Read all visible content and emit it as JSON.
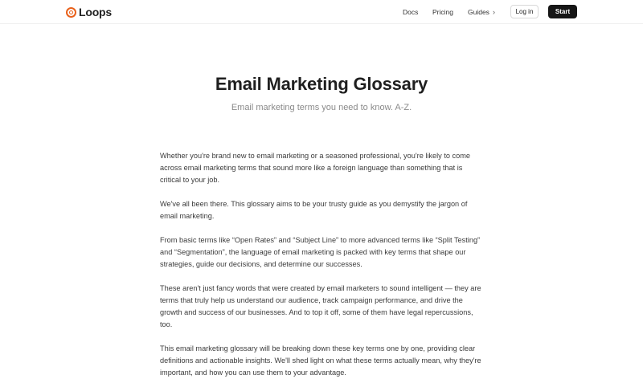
{
  "header": {
    "logo_text": "Loops",
    "nav": {
      "docs": "Docs",
      "pricing": "Pricing",
      "guides": "Guides",
      "guides_chevron": "›"
    },
    "login_label": "Log in",
    "start_label": "Start",
    "brand_color": "#e9611b"
  },
  "hero": {
    "title": "Email Marketing Glossary",
    "subtitle": "Email marketing terms you need to know. A-Z."
  },
  "article": {
    "paragraphs": [
      "Whether you're brand new to email marketing or a seasoned professional, you're likely to come across email marketing terms that sound more like a foreign language than something that is critical to your job.",
      "We've all been there. This glossary aims to be your trusty guide as you demystify the jargon of email marketing.",
      "From basic terms like “Open Rates” and “Subject Line” to more advanced terms like “Split Testing” and “Segmentation”, the language of email marketing is packed with key terms that shape our strategies, guide our decisions, and determine our successes.",
      "These aren't just fancy words that were created by email marketers to sound intelligent — they are terms that truly help us understand our audience, track campaign performance, and drive the growth and success of our businesses. And to top it off, some of them have legal repercussions, too.",
      "This email marketing glossary will be breaking down these key terms one by one, providing clear definitions and actionable insights. We'll shed light on what these terms actually mean, why they're important, and how you can use them to your advantage."
    ]
  }
}
